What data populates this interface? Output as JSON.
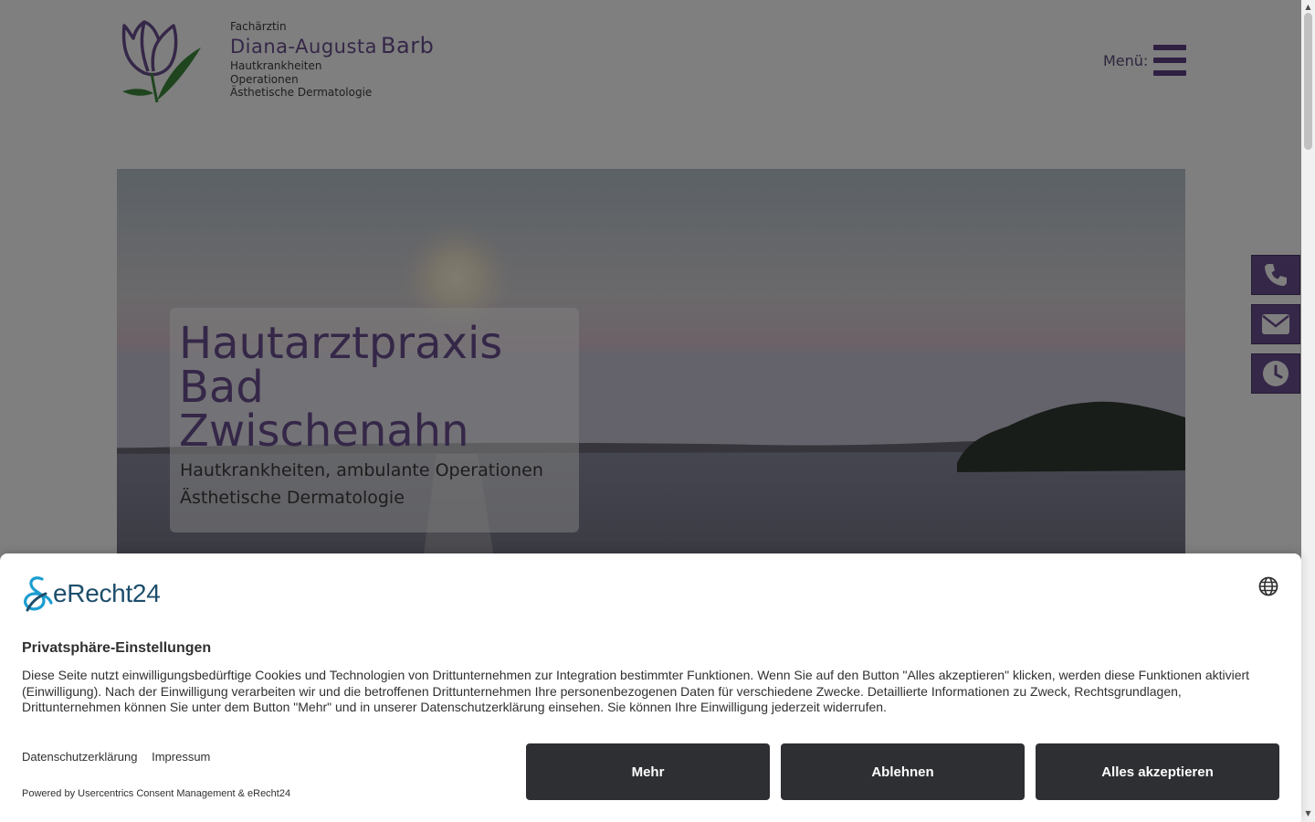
{
  "header": {
    "logo": {
      "prefix": "Fachärztin",
      "name_first": "Diana-Augusta",
      "name_last": "Barb",
      "lines": [
        "Hautkrankheiten",
        "Operationen",
        "Ästhetische Dermatologie"
      ]
    },
    "menu_label": "Menü:"
  },
  "hero": {
    "title_lines": [
      "Hautarztpraxis",
      "Bad",
      "Zwischenahn"
    ],
    "subtitle_lines": [
      "Hautkrankheiten, ambulante Operationen",
      "Ästhetische Dermatologie"
    ]
  },
  "side_buttons": [
    {
      "icon": "phone-icon"
    },
    {
      "icon": "envelope-icon"
    },
    {
      "icon": "clock-icon"
    }
  ],
  "consent": {
    "brand": "eRecht24",
    "title": "Privatsphäre-Einstellungen",
    "text": "Diese Seite nutzt einwilligungsbedürftige Cookies und Technologien von Drittunternehmen zur Integration bestimmter Funktionen. Wenn Sie auf den Button \"Alles akzeptieren\" klicken, werden diese Funktionen aktiviert (Einwilligung). Nach der Einwilligung verarbeiten wir und die betroffenen Drittunternehmen Ihre personenbezogenen Daten für verschiedene Zwecke. Detaillierte Informationen zu Zweck, Rechtsgrundlagen, Drittunternehmen können Sie unter dem Button \"Mehr\" und in unserer Datenschutzerklärung einsehen. Sie können Ihre Einwilligung jederzeit widerrufen.",
    "links": [
      "Datenschutzerklärung",
      "Impressum"
    ],
    "powered_by": "Powered by Usercentrics Consent Management & eRecht24",
    "buttons": {
      "more": "Mehr",
      "decline": "Ablehnen",
      "accept_all": "Alles akzeptieren"
    }
  },
  "colors": {
    "brand_purple": "#6b4f91",
    "button_dark": "#2d2f33"
  }
}
